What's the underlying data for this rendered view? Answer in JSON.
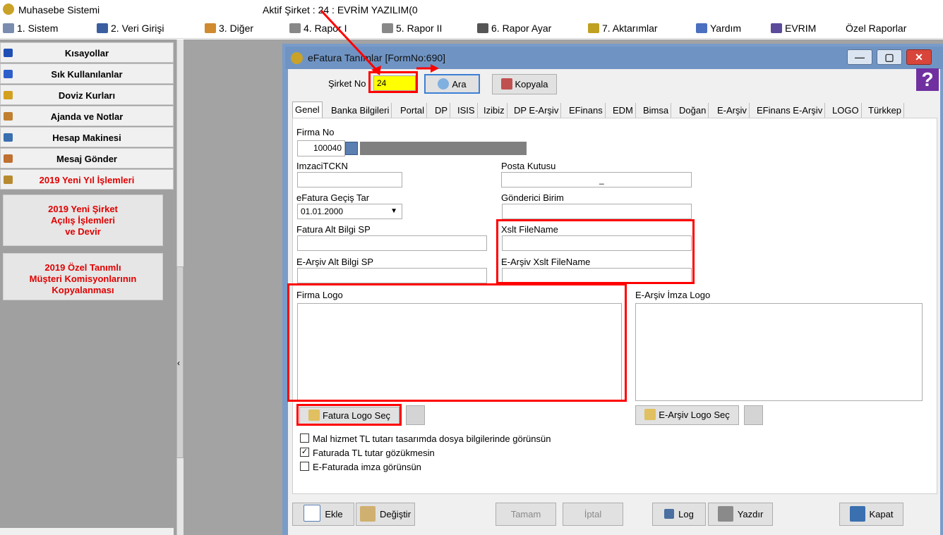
{
  "app": {
    "title": "Muhasebe Sistemi",
    "company": "Aktif Şirket : 24 : EVRİM YAZILIM(0"
  },
  "menu": [
    {
      "label": "1.  Sistem",
      "icon": "gear-icon"
    },
    {
      "label": "2.  Veri Girişi",
      "icon": "edit-icon"
    },
    {
      "label": "3.  Diğer",
      "icon": "tools-icon"
    },
    {
      "label": "4.  Rapor I",
      "icon": "printer-icon"
    },
    {
      "label": "5.  Rapor II",
      "icon": "printer-icon"
    },
    {
      "label": "6.  Rapor Ayar",
      "icon": "report-icon"
    },
    {
      "label": "7.  Aktarımlar",
      "icon": "transfer-icon"
    },
    {
      "label": "Yardım",
      "icon": "help-icon"
    },
    {
      "label": "EVRIM",
      "icon": "book-icon"
    },
    {
      "label": "Özel Raporlar",
      "icon": ""
    }
  ],
  "sidebar": {
    "items": [
      {
        "label": "Kısayollar",
        "color": "#1f4fb5"
      },
      {
        "label": "Sık Kullanılanlar",
        "color": "#2c5fc9"
      },
      {
        "label": "Doviz Kurları",
        "color": "#d4a020"
      },
      {
        "label": "Ajanda ve Notlar",
        "color": "#c08030"
      },
      {
        "label": "Hesap Makinesi",
        "color": "#3a6fb0"
      },
      {
        "label": "Mesaj Gönder",
        "color": "#c07030"
      },
      {
        "label": "2019 Yeni Yıl İşlemleri",
        "color": "#b88a30"
      }
    ],
    "boxes": [
      {
        "lines": [
          "2019 Yeni Şirket",
          "Açılış İşlemleri",
          "ve Devir"
        ]
      },
      {
        "lines": [
          "2019 Özel Tanımlı",
          "Müşteri Komisyonlarının",
          "Kopyalanması"
        ]
      }
    ]
  },
  "form": {
    "title": "eFatura Tanımlar [FormNo:690]",
    "sirket_no_label": "Şirket No",
    "sirket_no_value": "24",
    "ara_label": "Ara",
    "kopyala_label": "Kopyala",
    "tabs": [
      "Genel",
      "Banka Bilgileri",
      "Portal",
      "DP",
      "ISIS",
      "Izibiz",
      "DP E-Arşiv",
      "EFinans",
      "EDM",
      "Bimsa",
      "Doğan",
      "E-Arşiv",
      "EFinans E-Arşiv",
      "LOGO",
      "Türkkep"
    ],
    "active_tab": "Genel",
    "fields": {
      "firma_no_label": "Firma No",
      "firma_no_value": "100040",
      "imzaci_label": "ImzaciTCKN",
      "posta_kutusu_label": "Posta Kutusu",
      "posta_kutusu_value": "_",
      "gecis_tar_label": "eFatura Geçiş Tar",
      "gecis_tar_value": "01.01.2000",
      "gonderici_label": "Gönderici Birim",
      "fatura_alt_label": "Fatura Alt Bilgi SP",
      "xslt_label": "Xslt FileName",
      "earsiv_alt_label": "E-Arşiv Alt Bilgi SP",
      "earsiv_xslt_label": "E-Arşiv Xslt FileName",
      "firma_logo_label": "Firma Logo",
      "earsiv_imza_logo_label": "E-Arşiv İmza Logo",
      "fatura_logo_sec_label": "Fatura Logo Seç",
      "earsiv_logo_sec_label": "E-Arşiv Logo Seç"
    },
    "checkboxes": [
      {
        "label": "Mal hizmet TL tutarı tasarımda dosya bilgilerinde görünsün",
        "checked": false
      },
      {
        "label": "Faturada TL tutar gözükmesin",
        "checked": true
      },
      {
        "label": "E-Faturada imza görünsün",
        "checked": false
      }
    ],
    "buttons": {
      "ekle": "Ekle",
      "degistir": "Değiştir",
      "tamam": "Tamam",
      "iptal": "İptal",
      "log": "Log",
      "yazdir": "Yazdır",
      "kapat": "Kapat"
    }
  },
  "colors": {
    "highlight": "#ff0000",
    "sirket_no_bg": "#ffff00",
    "window_titlebar": "#6f94c4"
  }
}
